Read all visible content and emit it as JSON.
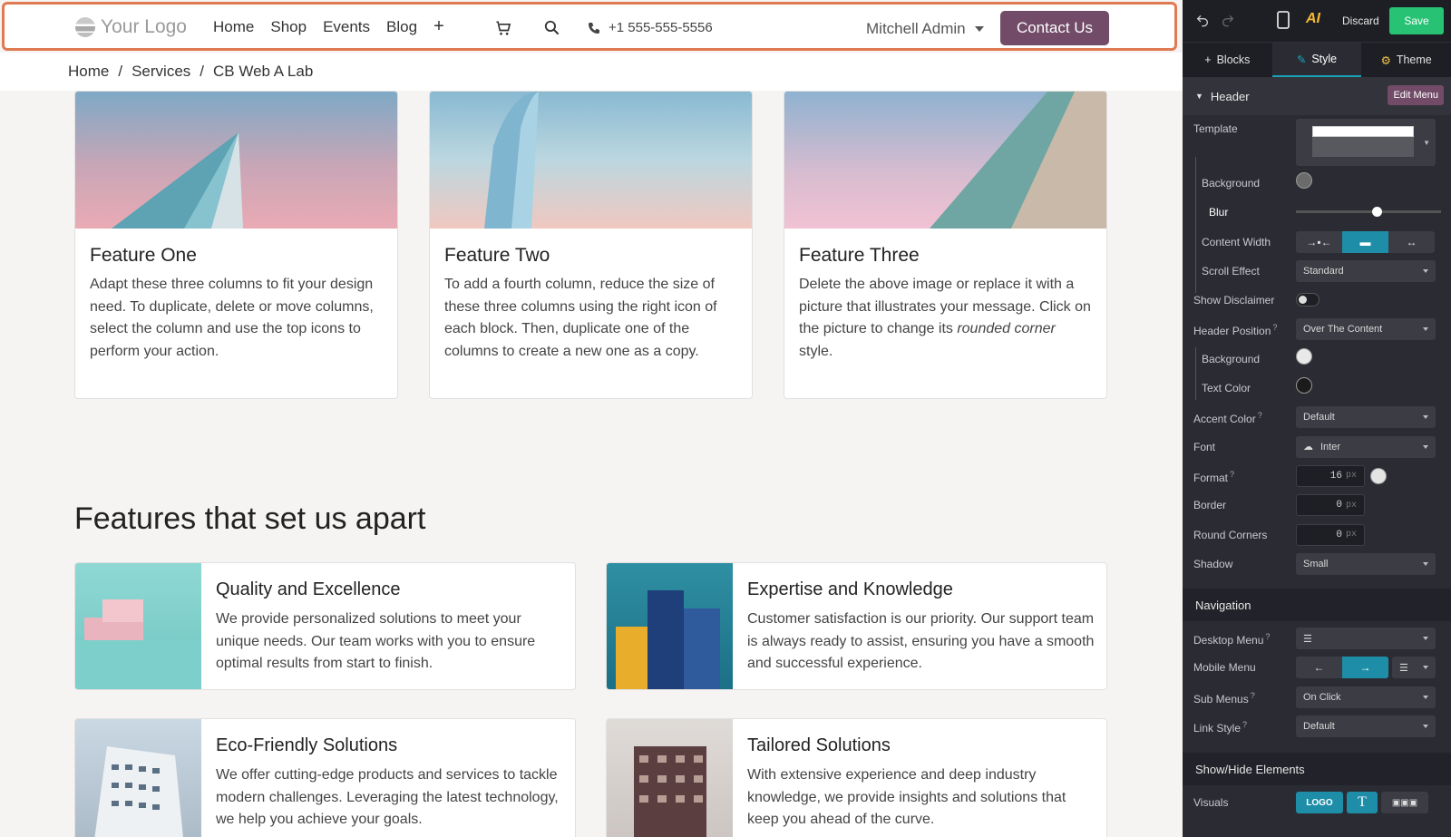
{
  "site": {
    "logo_text": "Your Logo",
    "nav": [
      "Home",
      "Shop",
      "Events",
      "Blog"
    ],
    "nav_plus": "+",
    "phone": "+1 555-555-5556",
    "user": "Mitchell Admin",
    "contact_button": "Contact Us",
    "breadcrumb": [
      "Home",
      "Services",
      "CB Web A Lab"
    ],
    "breadcrumb_sep": "/",
    "features": [
      {
        "title": "Feature One",
        "text": "Adapt these three columns to fit your design need. To duplicate, delete or move columns, select the column and use the top icons to perform your action."
      },
      {
        "title": "Feature Two",
        "text": "To add a fourth column, reduce the size of these three columns using the right icon of each block. Then, duplicate one of the columns to create a new one as a copy."
      },
      {
        "title": "Feature Three",
        "text_before": "Delete the above image or replace it with a picture that illustrates your message. Click on the picture to change its ",
        "text_em": "rounded corner",
        "text_after": " style."
      }
    ],
    "section_title": "Features that set us apart",
    "cards": [
      {
        "title": "Quality and Excellence",
        "text": "We provide personalized solutions to meet your unique needs. Our team works with you to ensure optimal results from start to finish."
      },
      {
        "title": "Expertise and Knowledge",
        "text": "Customer satisfaction is our priority. Our support team is always ready to assist, ensuring you have a smooth and successful experience."
      },
      {
        "title": "Eco-Friendly Solutions",
        "text": "We offer cutting-edge products and services to tackle modern challenges. Leveraging the latest technology, we help you achieve your goals."
      },
      {
        "title": "Tailored Solutions",
        "text": "With extensive experience and deep industry knowledge, we provide insights and solutions that keep you ahead of the curve."
      }
    ]
  },
  "editor": {
    "discard": "Discard",
    "save": "Save",
    "ai_label": "AI",
    "tabs": [
      "Blocks",
      "Style",
      "Theme"
    ],
    "header_section": "Header",
    "edit_menu": "Edit Menu",
    "labels": {
      "template": "Template",
      "background": "Background",
      "blur": "Blur",
      "content_width": "Content Width",
      "scroll_effect": "Scroll Effect",
      "show_disclaimer": "Show Disclaimer",
      "header_position": "Header Position",
      "background2": "Background",
      "text_color": "Text Color",
      "accent_color": "Accent Color",
      "font": "Font",
      "format": "Format",
      "border": "Border",
      "round_corners": "Round Corners",
      "shadow": "Shadow"
    },
    "help_mark": "?",
    "values": {
      "scroll_effect": "Standard",
      "header_position": "Over The Content",
      "accent_color": "Default",
      "font": "Inter",
      "format_size": "16",
      "border": "0",
      "round_corners": "0",
      "unit": "px",
      "shadow": "Small",
      "blur_level": 0.55
    },
    "navigation_section": "Navigation",
    "nav_labels": {
      "desktop_menu": "Desktop Menu",
      "mobile_menu": "Mobile Menu",
      "sub_menus": "Sub Menus",
      "link_style": "Link Style"
    },
    "nav_values": {
      "sub_menus": "On Click",
      "link_style": "Default"
    },
    "show_hide_section": "Show/Hide Elements",
    "visuals_label": "Visuals",
    "visuals_logo_button": "LOGO",
    "visuals_text_button": "T",
    "colors": {
      "accent": "#714b67",
      "save": "#27c274",
      "active_seg": "#1e8ea8"
    }
  }
}
